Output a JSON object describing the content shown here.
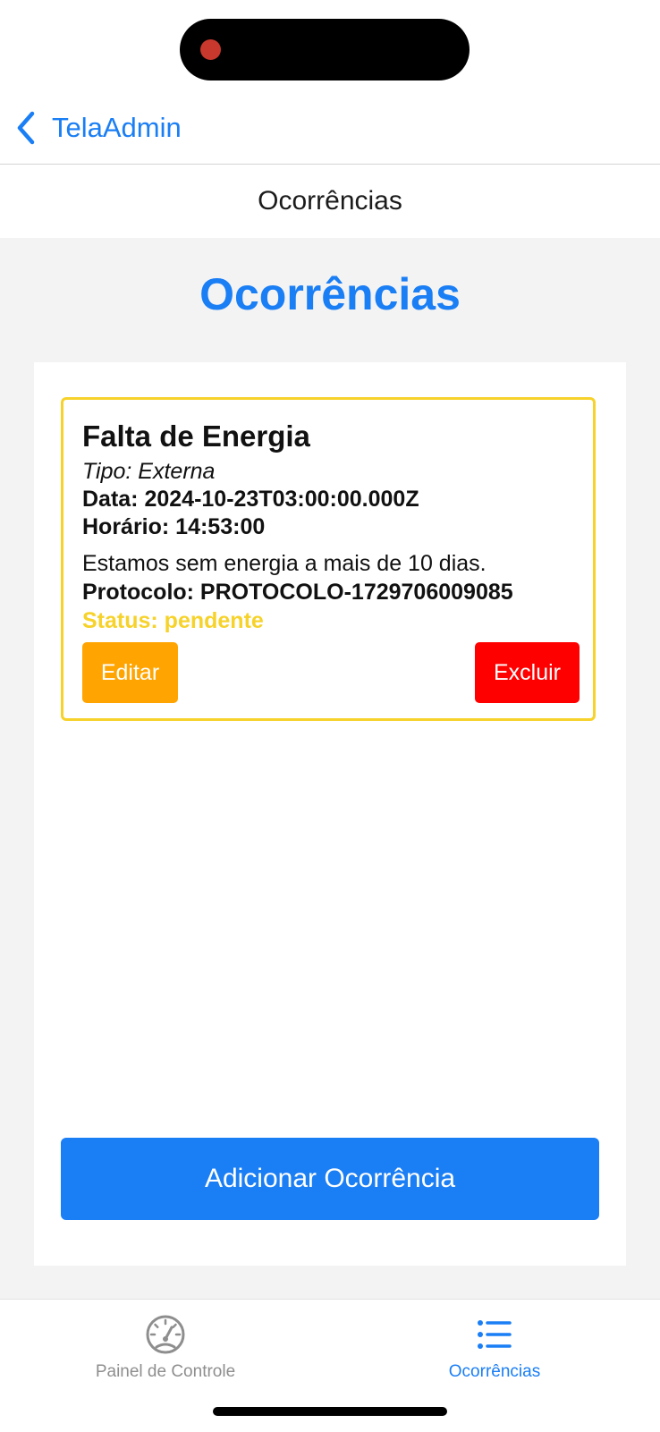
{
  "nav": {
    "back_label": "TelaAdmin",
    "header_title": "Ocorrências"
  },
  "page": {
    "title": "Ocorrências"
  },
  "occurrence": {
    "title": "Falta de Energia",
    "tipo": "Tipo: Externa",
    "data": "Data: 2024-10-23T03:00:00.000Z",
    "horario": "Horário: 14:53:00",
    "description": "Estamos sem energia a mais de 10 dias.",
    "protocolo": "Protocolo: PROTOCOLO-1729706009085",
    "status": "Status: pendente",
    "edit_label": "Editar",
    "delete_label": "Excluir"
  },
  "add_button": "Adicionar Ocorrência",
  "tabs": [
    {
      "label": "Painel de Controle",
      "icon": "speedometer-icon",
      "active": false
    },
    {
      "label": "Ocorrências",
      "icon": "list-icon",
      "active": true
    }
  ],
  "colors": {
    "accent": "#1a7ef5",
    "status_pending": "#f6d22a",
    "edit": "#ffa400",
    "delete": "#ff0000"
  }
}
